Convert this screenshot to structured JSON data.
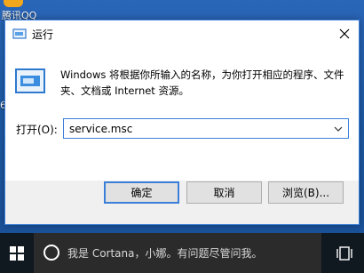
{
  "desktop": {
    "icon_label": "腾讯QQ",
    "edge_char": "6"
  },
  "dialog": {
    "title": "运行",
    "description": "Windows 将根据你所输入的名称，为你打开相应的程序、文件夹、文档或 Internet 资源。",
    "open_label": "打开(O):",
    "open_value": "service.msc",
    "buttons": {
      "ok": "确定",
      "cancel": "取消",
      "browse": "浏览(B)..."
    },
    "accent_color": "#3c7fd8"
  },
  "taskbar": {
    "search_placeholder": "我是 Cortana，小娜。有问题尽管问我。"
  }
}
